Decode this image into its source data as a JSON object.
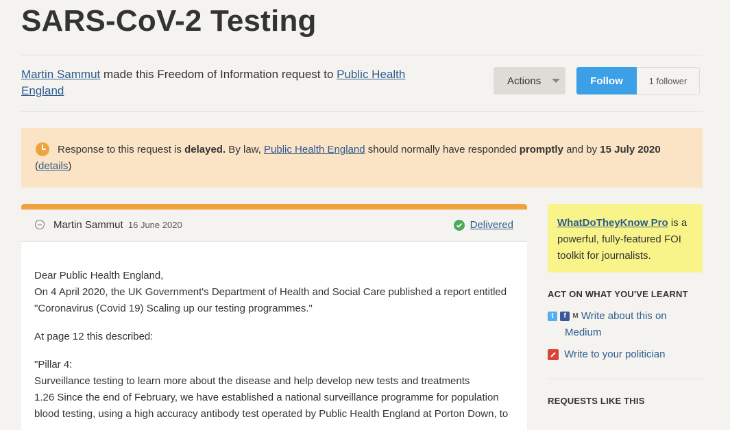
{
  "page": {
    "title": "SARS-CoV-2 Testing"
  },
  "byline": {
    "requester": "Martin Sammut",
    "middle_text": " made this Freedom of Information request to ",
    "authority": "Public Health England"
  },
  "toolbar": {
    "actions_label": "Actions",
    "follow_label": "Follow",
    "follower_count": "1 follower"
  },
  "notice": {
    "part1": "Response to this request is ",
    "delayed": "delayed.",
    "part2": " By law, ",
    "authority_link": "Public Health England",
    "part3": " should normally have responded ",
    "promptly": "promptly",
    "part4": " and by ",
    "due_date": "15 July 2020",
    "paren_open": "(",
    "details_link": "details",
    "paren_close": ")"
  },
  "message": {
    "author": "Martin Sammut",
    "date": "16 June 2020",
    "status": "Delivered",
    "body": [
      "Dear Public Health England,",
      "On 4 April 2020, the UK Government's Department of Health and Social Care published a report entitled \"Coronavirus (Covid 19) Scaling up our testing programmes.\"",
      "At page 12 this described:",
      "\"Pillar 4:",
      "Surveillance testing to learn more about the disease and help develop new tests and treatments",
      "1.26 Since the end of February, we have established a national surveillance programme for population blood testing, using a high accuracy antibody test operated by Public Health England at Porton Down, to"
    ]
  },
  "sidebar": {
    "promo_link": "WhatDoTheyKnow Pro",
    "promo_text": " is a powerful, fully-featured FOI toolkit for journalists.",
    "act_heading": "ACT ON WHAT YOU'VE LEARNT",
    "write_about_line1": "Write about this on",
    "write_about_line2": "Medium",
    "write_politician": "Write to your politician",
    "requests_heading": "REQUESTS LIKE THIS"
  },
  "colors": {
    "notice_bg": "#fbe3c6",
    "accent_orange": "#f0a23f",
    "follow_blue": "#3ba0e6",
    "promo_yellow": "#f8f48a",
    "link": "#2d5b8f",
    "delivered_green": "#4fa85c"
  }
}
